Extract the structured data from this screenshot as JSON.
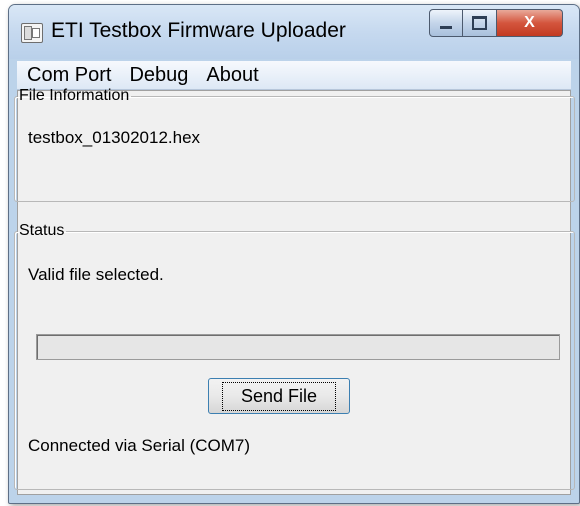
{
  "window": {
    "title": "ETI Testbox Firmware Uploader",
    "icon": "app-window-icon",
    "caption_buttons": {
      "minimize": "minimize-icon",
      "maximize": "maximize-icon",
      "close": "X"
    }
  },
  "menu": {
    "items": [
      {
        "label": "Com Port"
      },
      {
        "label": "Debug"
      },
      {
        "label": "About"
      }
    ]
  },
  "file_info": {
    "legend": "File Information",
    "filename": "testbox_01302012.hex"
  },
  "status": {
    "legend": "Status",
    "message": "Valid file selected.",
    "progress": 0,
    "send_button_label": "Send File",
    "connection": "Connected via Serial (COM7)"
  },
  "colors": {
    "title_bar": "#c6d9ef",
    "close_button": "#c8452c",
    "dialog_background": "#f0f0f0",
    "button_focus_border": "#3c7fb1"
  }
}
